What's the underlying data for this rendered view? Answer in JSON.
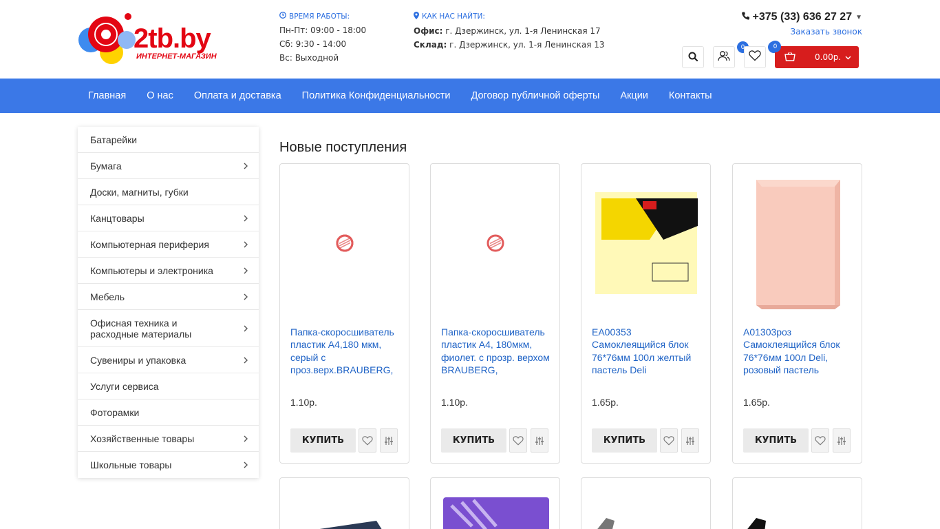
{
  "header": {
    "logo_text": "2tb.by",
    "logo_sub": "ИНТЕРНЕТ-МАГАЗИН",
    "hours": {
      "title": "ВРЕМЯ РАБОТЫ:",
      "lines": [
        "Пн-Пт: 09:00 - 18:00",
        "Сб: 9:30 - 14:00",
        "Вс: Выходной"
      ]
    },
    "location": {
      "title": "КАК НАС НАЙТИ:",
      "office_label": "Офис:",
      "office_value": " г. Дзержинск, ул. 1-я Ленинская 17",
      "warehouse_label": "Склад:",
      "warehouse_value": " г. Дзержинск, ул. 1-я Ленинская 13"
    },
    "phone": "+375 (33) 636 27 27",
    "callback": "Заказать звонок",
    "compare_count": "0",
    "wishlist_count": "0",
    "cart_count": "0",
    "cart_total": "0.00р."
  },
  "nav": [
    "Главная",
    "О нас",
    "Оплата и доставка",
    "Политика Конфиденциальности",
    "Договор публичной оферты",
    "Акции",
    "Контакты"
  ],
  "sidebar": [
    {
      "label": "Батарейки",
      "arrow": false
    },
    {
      "label": "Бумага",
      "arrow": true
    },
    {
      "label": "Доски, магниты, губки",
      "arrow": false
    },
    {
      "label": "Канцтовары",
      "arrow": true
    },
    {
      "label": "Компьютерная периферия",
      "arrow": true
    },
    {
      "label": "Компьютеры и электроника",
      "arrow": true
    },
    {
      "label": "Мебель",
      "arrow": true
    },
    {
      "label": "Офисная техника и расходные материалы",
      "arrow": true
    },
    {
      "label": "Сувениры и упаковка",
      "arrow": true
    },
    {
      "label": "Услуги сервиса",
      "arrow": false
    },
    {
      "label": "Фоторамки",
      "arrow": false
    },
    {
      "label": "Хозяйственные товары",
      "arrow": true
    },
    {
      "label": "Школьные товары",
      "arrow": true
    }
  ],
  "main": {
    "section_title": "Новые поступления",
    "buy_label": "КУПИТЬ",
    "products": [
      {
        "name": "Папка-скоросшиватель пластик А4,180 мкм, серый с проз.верх.BRAUBERG,",
        "price": "1.10р.",
        "image": "no-image-icon"
      },
      {
        "name": "Папка-скоросшиватель пластик А4, 180мкм, фиолет. с прозр. верхом BRAUBERG,",
        "price": "1.10р.",
        "image": "no-image-icon"
      },
      {
        "name": "EA00353 Самоклеящийся блок 76*76мм 100л желтый пастель Deli",
        "price": "1.65р.",
        "image": "sticky-notes-yellow"
      },
      {
        "name": "A01303роз Самоклеящийся блок 76*76мм 100л Deli, розовый пастель",
        "price": "1.65р.",
        "image": "sticky-notes-pink"
      }
    ]
  },
  "colors": {
    "accent": "#3b78e7",
    "brand_red": "#d71d1d",
    "link": "#1f63c6"
  }
}
